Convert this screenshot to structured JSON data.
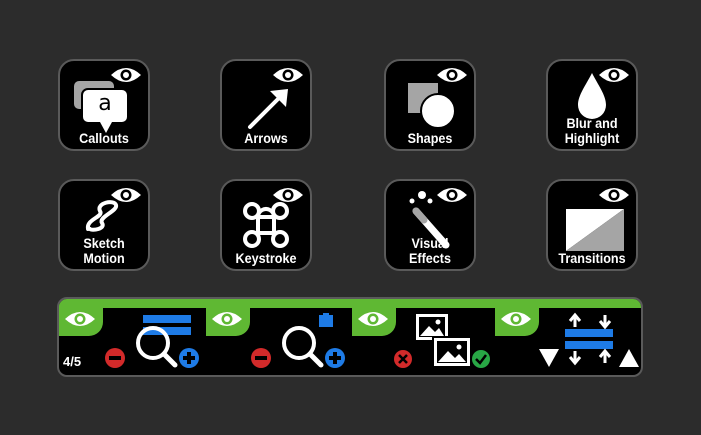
{
  "tiles": [
    {
      "label": "Callouts",
      "icon": "callout-icon"
    },
    {
      "label": "Arrows",
      "icon": "arrow-icon"
    },
    {
      "label": "Shapes",
      "icon": "shapes-icon"
    },
    {
      "label": "Blur and\nHighlight",
      "icon": "blur-drop-icon"
    },
    {
      "label": "Sketch\nMotion",
      "icon": "sketch-squiggle-icon"
    },
    {
      "label": "Keystroke",
      "icon": "command-key-icon"
    },
    {
      "label": "Visual Effects",
      "icon": "magic-wand-icon"
    },
    {
      "label": "Transitions",
      "icon": "transition-icon"
    }
  ],
  "callout_letter": "a",
  "toolbar": {
    "page_count": "4/5",
    "tools": [
      "zoom-n-pan-icon",
      "zoom-icon",
      "image-swap-icon",
      "align-spacing-icon"
    ]
  },
  "colors": {
    "background": "#2c2c2c",
    "tile": "#000000",
    "border": "#5a5a5a",
    "green": "#5fb833",
    "blue": "#1e7be6",
    "red": "#d22a2a",
    "check_green": "#28a745"
  }
}
